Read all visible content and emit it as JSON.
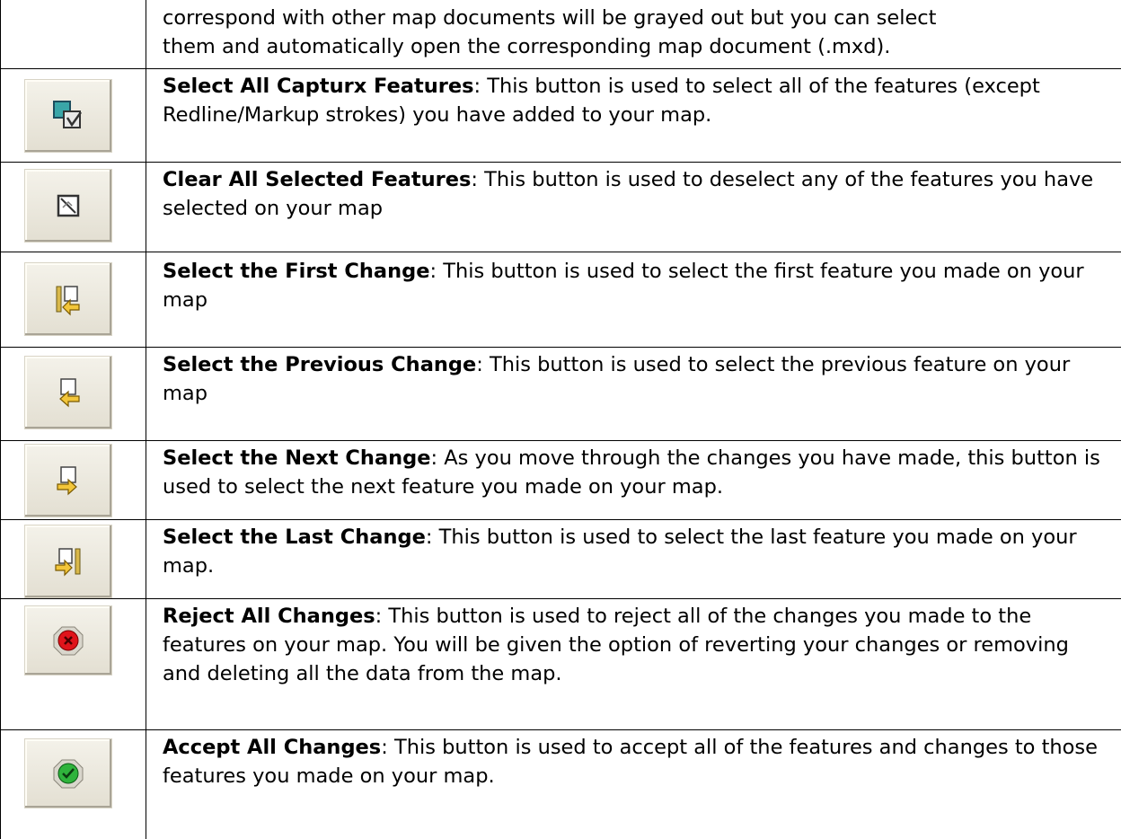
{
  "intro": {
    "line1": "correspond with other map documents will be grayed out but you can select",
    "line2": "them and automatically open the corresponding map document (.mxd)."
  },
  "rows": [
    {
      "title": "Select All Capturx Features",
      "text": ": This button is used to select all of the features (except Redline/Markup strokes) you have added to your map.",
      "icon": "select-all-features-icon"
    },
    {
      "title": "Clear All Selected Features",
      "text": ": This button is used to deselect any of the features you have selected on your map",
      "icon": "clear-selection-icon"
    },
    {
      "title": "Select the First Change",
      "text": ": This button is used to select the first feature you made on your map",
      "icon": "first-change-icon"
    },
    {
      "title": "Select the Previous Change",
      "text": ": This button is used to select the previous feature on your map",
      "icon": "previous-change-icon"
    },
    {
      "title": "Select the Next Change",
      "text": ": As you move through the changes you have made, this button is used to select the next feature you made on your map.",
      "icon": "next-change-icon"
    },
    {
      "title": "Select the Last Change",
      "text": ": This button is used to select the last feature you made on your map.",
      "icon": "last-change-icon"
    },
    {
      "title": "Reject All Changes",
      "text": ": This button is used to reject all of the changes you made to the features on your map. You will be given the option of reverting your changes or removing and deleting all the data from the map.",
      "icon": "reject-all-icon"
    },
    {
      "title": "Accept All Changes",
      "text": ": This button is used to accept all of the features and changes to those features you made on your map.",
      "icon": "accept-all-icon"
    }
  ]
}
